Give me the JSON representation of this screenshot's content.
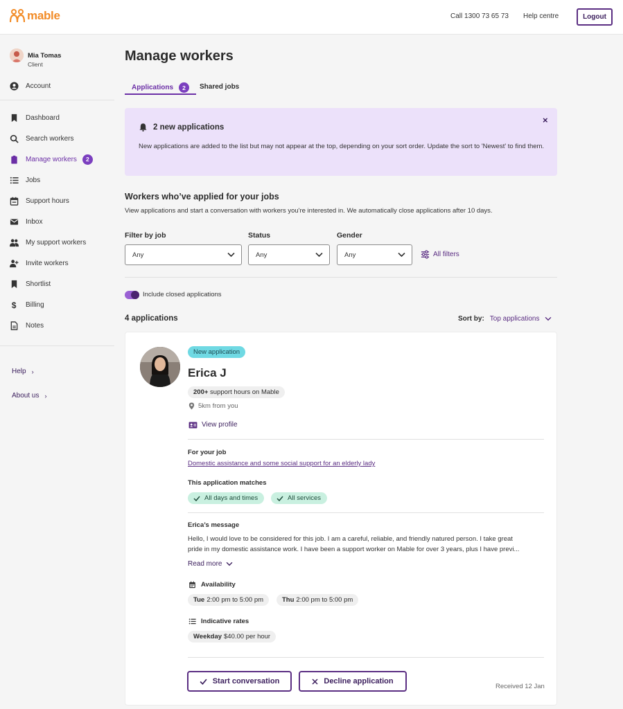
{
  "header": {
    "logo_text": "mable",
    "phone": "Call 1300 73 65 73",
    "help": "Help centre",
    "logout": "Logout"
  },
  "sidebar": {
    "user_name": "Mia Tomas",
    "user_role": "Client",
    "account": "Account",
    "items": [
      {
        "label": "Dashboard",
        "icon": "bookmark-icon"
      },
      {
        "label": "Search workers",
        "icon": "search-icon"
      },
      {
        "label": "Manage workers",
        "icon": "clipboard-icon",
        "badge": "2",
        "active": true
      },
      {
        "label": "Jobs",
        "icon": "list-icon"
      },
      {
        "label": "Support hours",
        "icon": "calendar-icon"
      },
      {
        "label": "Inbox",
        "icon": "mail-icon"
      },
      {
        "label": "My support workers",
        "icon": "people-icon"
      },
      {
        "label": "Invite workers",
        "icon": "person-add-icon"
      },
      {
        "label": "Shortlist",
        "icon": "bookmark-icon"
      },
      {
        "label": "Billing",
        "icon": "dollar-icon"
      },
      {
        "label": "Notes",
        "icon": "note-icon"
      }
    ],
    "help": "Help",
    "about": "About us"
  },
  "main": {
    "title": "Manage workers",
    "tabs": [
      {
        "label": "Applications",
        "badge": "2"
      },
      {
        "label": "Shared jobs"
      }
    ],
    "alert": {
      "title": "2 new applications",
      "text": "New applications are added to the list but may not appear at the top, depending on your sort order. Update the sort to 'Newest' to find them.",
      "close": "×"
    },
    "section_title": "Workers who’ve applied for your jobs",
    "section_desc": "View applications and start a conversation with workers you're interested in. We automatically close applications after 10 days.",
    "filters": {
      "job_label": "Filter by job",
      "job_value": "Any",
      "status_label": "Status",
      "status_value": "Any",
      "gender_label": "Gender",
      "gender_value": "Any",
      "all_filters": "All filters"
    },
    "toggle_label": "Include closed applications",
    "count": "4 applications",
    "sort_label": "Sort by:",
    "sort_value": "Top applications"
  },
  "card": {
    "badge": "New application",
    "name": "Erica J",
    "hours_bold": "200+",
    "hours_rest": "support hours on Mable",
    "distance": "5km from you",
    "view_profile": "View profile",
    "for_job_label": "For your job",
    "job_title": "Domestic assistance and some social support for an elderly lady",
    "matches_label": "This application matches",
    "matches": [
      "All days and times",
      "All services"
    ],
    "message_label": "Erica’s message",
    "message_line1": "Hello, I would love to be considered for this job. I am a careful, reliable, and friendly natured person. I take great",
    "message_line2": "pride in my domestic assistance work. I have been a support worker on Mable for over 3 years, plus I have previ...",
    "read_more": "Read more",
    "availability_label": "Availability",
    "availability": [
      {
        "day": "Tue",
        "time": "2:00 pm to 5:00 pm"
      },
      {
        "day": "Thu",
        "time": "2:00 pm to 5:00 pm"
      }
    ],
    "rates_label": "Indicative rates",
    "rate_day": "Weekday",
    "rate_value": "$40.00 per hour",
    "start_btn": "Start conversation",
    "decline_btn": "Decline application",
    "received": "Received 12 Jan"
  },
  "colors": {
    "brand_orange": "#f28c28",
    "brand_purple": "#5a2d82",
    "alert_bg": "#ece1fa",
    "new_badge": "#6fd9e3",
    "match_bg": "#c9f0e0"
  }
}
